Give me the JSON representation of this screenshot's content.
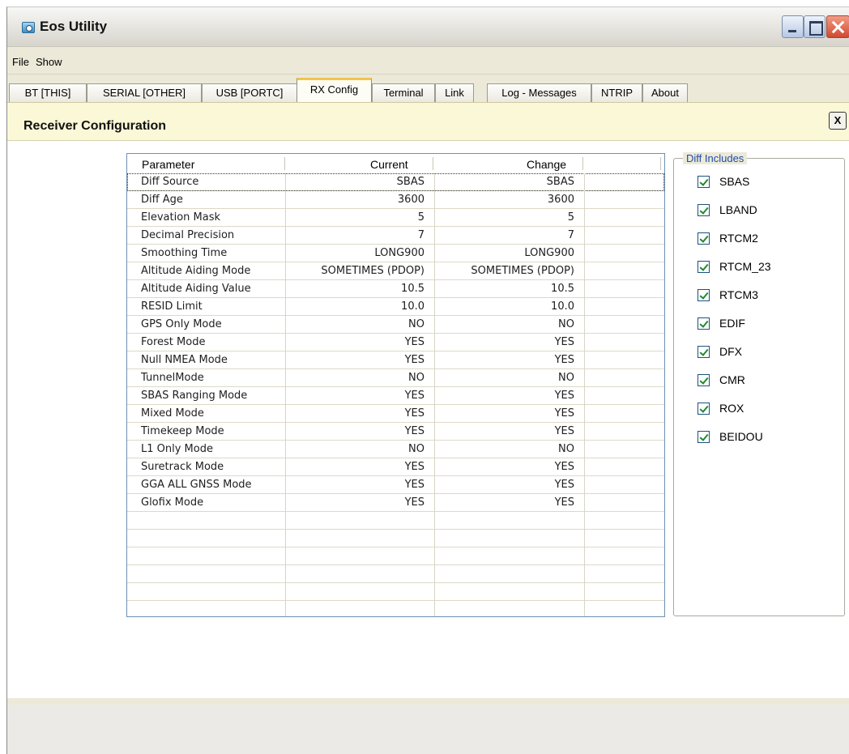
{
  "window": {
    "title": "Eos Utility"
  },
  "menu": {
    "file": "File",
    "show": "Show"
  },
  "tabs": [
    {
      "label": "BT [THIS]"
    },
    {
      "label": "SERIAL [OTHER]"
    },
    {
      "label": "USB [PORTC]"
    },
    {
      "label": "RX Config",
      "active": true
    },
    {
      "label": "Terminal"
    },
    {
      "label": "Link"
    },
    {
      "label": "Log - Messages"
    },
    {
      "label": "NTRIP"
    },
    {
      "label": "About"
    }
  ],
  "panel": {
    "title": "Receiver Configuration",
    "close_label": "X"
  },
  "grid": {
    "headers": {
      "parameter": "Parameter",
      "current": "Current",
      "change": "Change"
    },
    "rows": [
      {
        "parameter": "Diff Source",
        "current": "SBAS",
        "change": "SBAS"
      },
      {
        "parameter": "Diff Age",
        "current": "3600",
        "change": "3600"
      },
      {
        "parameter": "Elevation Mask",
        "current": "5",
        "change": "5"
      },
      {
        "parameter": "Decimal Precision",
        "current": "7",
        "change": "7"
      },
      {
        "parameter": "Smoothing Time",
        "current": "LONG900",
        "change": "LONG900"
      },
      {
        "parameter": "Altitude Aiding Mode",
        "current": "SOMETIMES (PDOP)",
        "change": "SOMETIMES (PDOP)"
      },
      {
        "parameter": "Altitude Aiding Value",
        "current": "10.5",
        "change": "10.5"
      },
      {
        "parameter": "RESID Limit",
        "current": "10.0",
        "change": "10.0"
      },
      {
        "parameter": "GPS Only Mode",
        "current": "NO",
        "change": "NO"
      },
      {
        "parameter": "Forest Mode",
        "current": "YES",
        "change": "YES"
      },
      {
        "parameter": "Null NMEA Mode",
        "current": "YES",
        "change": "YES"
      },
      {
        "parameter": "TunnelMode",
        "current": "NO",
        "change": "NO"
      },
      {
        "parameter": "SBAS Ranging Mode",
        "current": "YES",
        "change": "YES"
      },
      {
        "parameter": "Mixed Mode",
        "current": "YES",
        "change": "YES"
      },
      {
        "parameter": "Timekeep Mode",
        "current": "YES",
        "change": "YES"
      },
      {
        "parameter": "L1 Only Mode",
        "current": "NO",
        "change": "NO"
      },
      {
        "parameter": "Suretrack Mode",
        "current": "YES",
        "change": "YES"
      },
      {
        "parameter": "GGA ALL GNSS Mode",
        "current": "YES",
        "change": "YES"
      },
      {
        "parameter": "Glofix Mode",
        "current": "YES",
        "change": "YES"
      },
      {
        "parameter": "",
        "current": "",
        "change": ""
      },
      {
        "parameter": "",
        "current": "",
        "change": ""
      },
      {
        "parameter": "",
        "current": "",
        "change": ""
      },
      {
        "parameter": "",
        "current": "",
        "change": ""
      },
      {
        "parameter": "",
        "current": "",
        "change": ""
      }
    ]
  },
  "diff_includes": {
    "legend": "Diff Includes",
    "items": [
      {
        "label": "SBAS",
        "checked": true
      },
      {
        "label": "LBAND",
        "checked": true
      },
      {
        "label": "RTCM2",
        "checked": true
      },
      {
        "label": "RTCM_23",
        "checked": true
      },
      {
        "label": "RTCM3",
        "checked": true
      },
      {
        "label": "EDIF",
        "checked": true
      },
      {
        "label": "DFX",
        "checked": true
      },
      {
        "label": "CMR",
        "checked": true
      },
      {
        "label": "ROX",
        "checked": true
      },
      {
        "label": "BEIDOU",
        "checked": true
      }
    ]
  }
}
